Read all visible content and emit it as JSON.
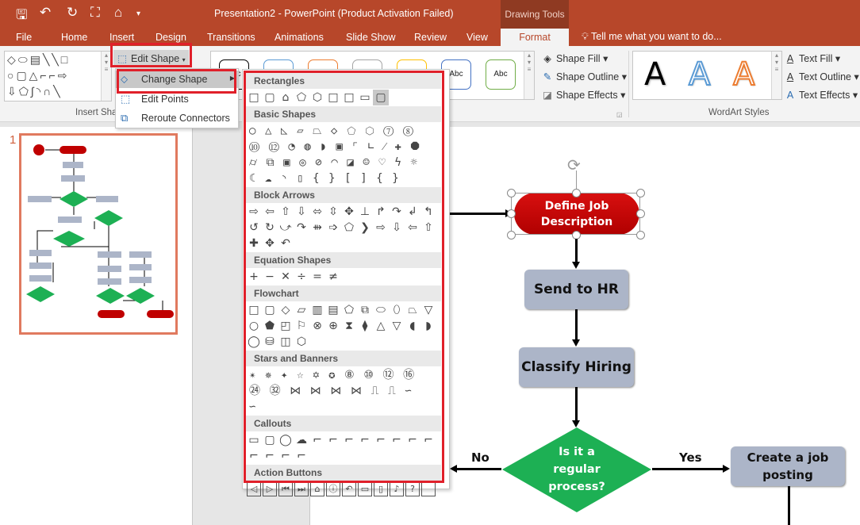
{
  "window": {
    "title": "Presentation2 - PowerPoint (Product Activation Failed)",
    "context_tab_group": "Drawing Tools"
  },
  "quick_access": [
    {
      "icon": "save-icon",
      "glyph": "🖫"
    },
    {
      "icon": "undo-icon",
      "glyph": "↶"
    },
    {
      "icon": "redo-icon",
      "glyph": "↻"
    },
    {
      "icon": "start-slideshow-icon",
      "glyph": "⛶"
    },
    {
      "icon": "format-painter-icon",
      "glyph": "⌂"
    },
    {
      "icon": "customize-icon",
      "glyph": "▾"
    }
  ],
  "tabs": [
    "File",
    "Home",
    "Insert",
    "Design",
    "Transitions",
    "Animations",
    "Slide Show",
    "Review",
    "View",
    "Format"
  ],
  "tell_me": "Tell me what you want to do...",
  "ribbon": {
    "insert_shapes_label": "Insert Sha",
    "edit_shape": "Edit Shape",
    "shape_fill": "Shape Fill",
    "shape_outline": "Shape Outline",
    "shape_effects": "Shape Effects",
    "style_sample": "Abc",
    "style_colors": [
      "#000000",
      "#5b9bd5",
      "#ed7d31",
      "#a5a5a5",
      "#ffc000",
      "#4472c4",
      "#70ad47"
    ],
    "wordart_letter": "A",
    "wordart_colors": [
      "#000000",
      "#5b9bd5",
      "#ed7d31"
    ],
    "text_fill": "Text Fill",
    "text_outline": "Text Outline",
    "text_effects": "Text Effects",
    "wordart_label": "WordArt Styles"
  },
  "edit_shape_menu": {
    "items": [
      "Change Shape",
      "Edit Points",
      "Reroute Connectors"
    ],
    "highlighted": "Change Shape"
  },
  "shape_gallery": [
    {
      "name": "Rectangles",
      "shapes": "□▢⌂⬠⬡□□▭▢",
      "selected": 8
    },
    {
      "name": "Basic Shapes",
      "shapes": "○△◺▱⏢◇⬠⬡⑦⑧⑩⑫◔◍◗▣⌜∟⁄✚⯃⌭⧉▣◎⊘◠◪☺♡ϟ☼☾☁◝▯{}[]{}"
    },
    {
      "name": "Block Arrows",
      "shapes": "⇨⇦⇧⇩⬄⇳✥⊥↱↷↲↰↺↻⤻↷⇻➩⬠❯⇨⇩⇦⇧✚✥↶"
    },
    {
      "name": "Equation Shapes",
      "shapes": "+−✕÷=≠"
    },
    {
      "name": "Flowchart",
      "shapes": "□▢◇▱▥▤⬠⧉⬭⬯⏢▽○⬟◰⚐⊗⊕⧗⧫△▽◖◗◯⛁◫⬡"
    },
    {
      "name": "Stars and Banners",
      "shapes": "✴✵✦☆✡✪⑧⑩⑫⑯㉔㉜⋈⋈⋈⋈⎍⎍∽∽"
    },
    {
      "name": "Callouts",
      "shapes": "▭▢◯☁⌐⌐⌐⌐⌐⌐⌐⌐⌐⌐⌐⌐"
    },
    {
      "name": "Action Buttons",
      "shapes": "◁▷⏮⏭⌂ⓘ↶▭▯♪? ",
      "boxed": true
    }
  ],
  "slides_panel": {
    "slide_number": "1"
  },
  "flowchart": {
    "define": "Define Job Description",
    "send": "Send to HR",
    "classify": "Classify Hiring",
    "decision": "Is it a regular process?",
    "no": "No",
    "yes": "Yes",
    "create": "Create a job posting",
    "colors": {
      "terminal": "#c00000",
      "process": "#acb5c8",
      "decision": "#1db054"
    }
  }
}
